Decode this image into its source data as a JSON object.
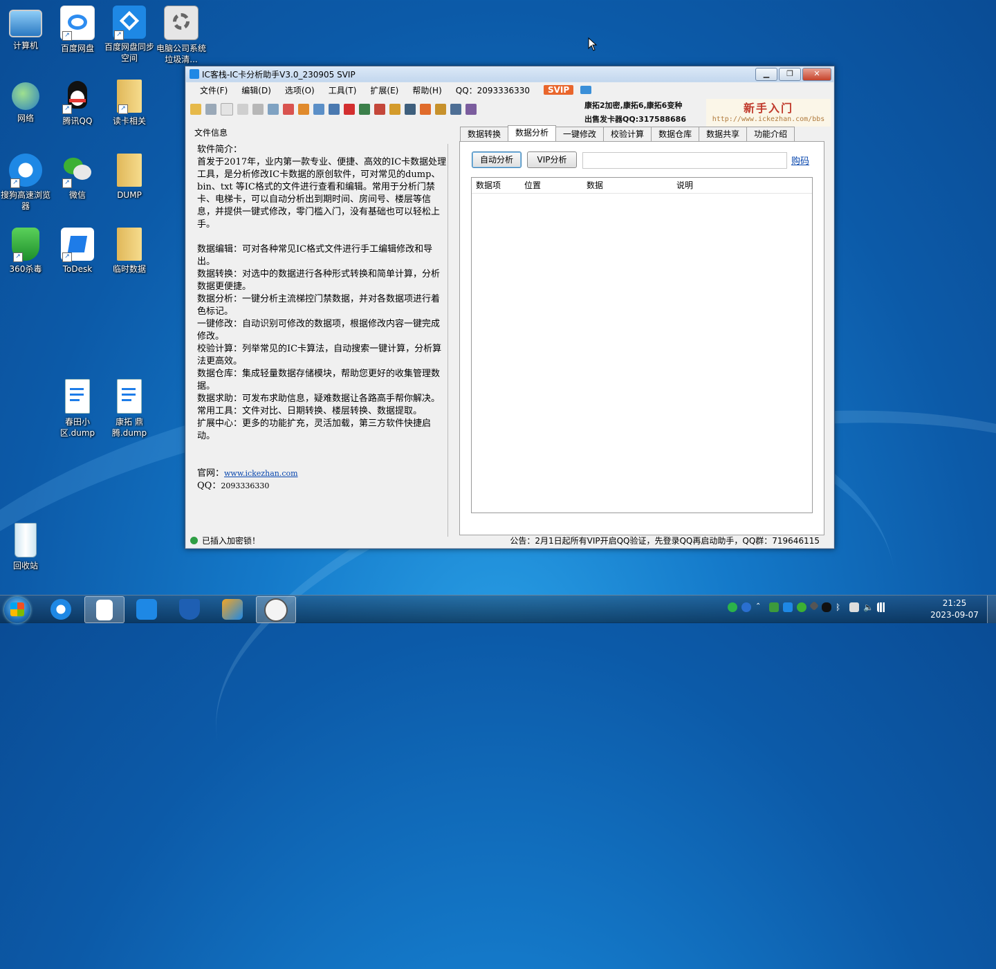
{
  "desktop": {
    "icons": [
      {
        "label": "计算机",
        "icon": "computer-icon"
      },
      {
        "label": "百度网盘",
        "icon": "baidu-netdisk-icon"
      },
      {
        "label": "百度网盘同步空间",
        "icon": "baidu-sync-icon"
      },
      {
        "label": "电脑公司系统垃圾清...",
        "icon": "cleaner-icon"
      },
      {
        "label": "网络",
        "icon": "network-icon"
      },
      {
        "label": "腾讯QQ",
        "icon": "qq-icon"
      },
      {
        "label": "读卡相关",
        "icon": "folder-icon"
      },
      {
        "label": "搜狗高速浏览器",
        "icon": "sogou-browser-icon"
      },
      {
        "label": "微信",
        "icon": "wechat-icon"
      },
      {
        "label": "DUMP",
        "icon": "folder-icon"
      },
      {
        "label": "360杀毒",
        "icon": "360-antivirus-icon"
      },
      {
        "label": "ToDesk",
        "icon": "todesk-icon"
      },
      {
        "label": "临时数据",
        "icon": "folder-icon"
      },
      {
        "label": "春田小区.dump",
        "icon": "dump-file-icon"
      },
      {
        "label": "康拓 鼎腾.dump",
        "icon": "dump-file-icon"
      },
      {
        "label": "回收站",
        "icon": "recycle-bin-icon"
      }
    ]
  },
  "window": {
    "title": "IC客栈-IC卡分析助手V3.0_230905 SVIP",
    "menu": [
      "文件(F)",
      "编辑(D)",
      "选项(O)",
      "工具(T)",
      "扩展(E)",
      "帮助(H)"
    ],
    "qq": "QQ：2093336330",
    "svip": "SVIP",
    "promo_line1": "康拓2加密,康拓6,康拓6变种",
    "promo_line2": "出售发卡器QQ:317588686",
    "promo_title": "新手入门",
    "promo_url": "http://www.ickezhan.com/bbs",
    "file_info_label": "文件信息",
    "info": {
      "intro_title": "软件简介：",
      "intro": "首发于2017年，业内第一款专业、便捷、高效的IC卡数据处理工具，是分析修改IC卡数据的原创软件，可对常见的dump、bin、txt 等IC格式的文件进行查看和编辑。常用于分析门禁卡、电梯卡，可以自动分析出到期时间、房间号、楼层等信息，并提供一键式修改，零门槛入门，没有基础也可以轻松上手。",
      "features": [
        "数据编辑：可对各种常见IC格式文件进行手工编辑修改和导出。",
        "数据转换：对选中的数据进行各种形式转换和简单计算，分析数据更便捷。",
        "数据分析：一键分析主流梯控门禁数据，并对各数据项进行着色标记。",
        "一键修改：自动识别可修改的数据项，根据修改内容一键完成修改。",
        "校验计算：列举常见的IC卡算法，自动搜索一键计算，分析算法更高效。",
        "数据仓库：集成轻量数据存储模块，帮助您更好的收集管理数据。",
        "数据求助：可发布求助信息，疑难数据让各路高手帮你解决。",
        "常用工具：文件对比、日期转换、楼层转换、数据提取。",
        "扩展中心：更多的功能扩充，灵活加载，第三方软件快捷启动。"
      ],
      "website_label": "官网：",
      "website": "www.ickezhan.com",
      "qq_label": "QQ：",
      "qq_value": "2093336330"
    },
    "tabs": [
      "数据转换",
      "数据分析",
      "一键修改",
      "校验计算",
      "数据仓库",
      "数据共享",
      "功能介绍"
    ],
    "active_tab": "数据分析",
    "auto_analyze": "自动分析",
    "vip_analyze": "VIP分析",
    "vip_input_value": "",
    "buy_code": "购码",
    "grid_columns": [
      "数据项",
      "位置",
      "数据",
      "说明"
    ],
    "status_left": "已插入加密锁！",
    "status_notice": "公告：2月1日起所有VIP开启QQ验证，先登录QQ再启动助手，QQ群：719646115"
  },
  "taskbar": {
    "time": "21:25",
    "date": "2023-09-07"
  }
}
